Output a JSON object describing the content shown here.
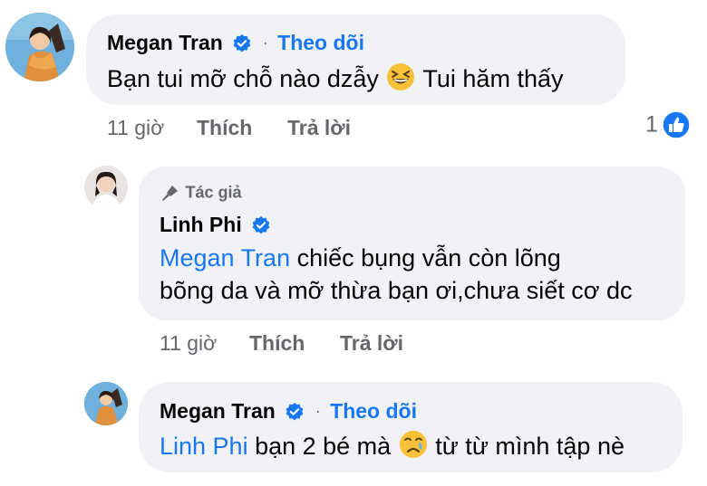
{
  "comments": [
    {
      "author": "Megan Tran",
      "follow_label": "Theo dõi",
      "separator": "·",
      "text": "Bạn tui mỡ chỗ nào dzẫy",
      "text_after_emoji": "Tui hăm thấy",
      "emoji": "grinning-squinting-face",
      "time": "11 giờ",
      "like_label": "Thích",
      "reply_label": "Trả lời",
      "reaction_count": "1",
      "reaction_icon": "like-reaction-icon"
    },
    {
      "badge": "Tác giả",
      "author": "Linh Phi",
      "mention": "Megan Tran",
      "text_line1": " chiếc bụng vẫn còn lõng",
      "text_line2": "bõng da và mỡ thừa bạn ơi,chưa siết cơ dc",
      "time": "11 giờ",
      "like_label": "Thích",
      "reply_label": "Trả lời"
    },
    {
      "author": "Megan Tran",
      "follow_label": "Theo dõi",
      "separator": "·",
      "mention": "Linh Phi",
      "text": " bạn 2 bé mà",
      "text_after_emoji": "từ từ mình tập nè",
      "emoji": "crying-face"
    }
  ],
  "colors": {
    "accent": "#1877f2",
    "bubble": "#f0f2f5",
    "muted": "#65676b",
    "text": "#050505"
  }
}
